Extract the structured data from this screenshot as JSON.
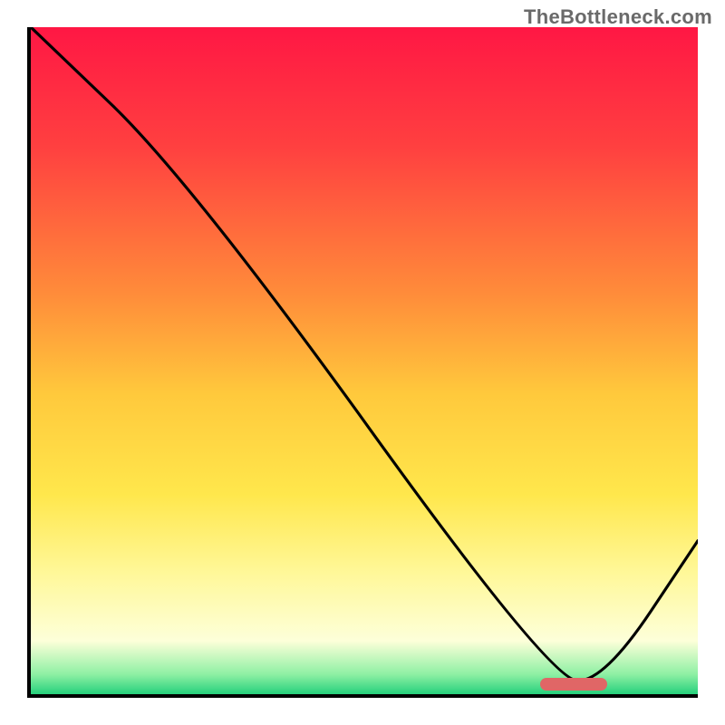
{
  "watermark": "TheBottleneck.com",
  "chart_data": {
    "type": "line",
    "title": "",
    "xlabel": "",
    "ylabel": "",
    "xlim": [
      0,
      100
    ],
    "ylim": [
      0,
      100
    ],
    "grid": false,
    "legend": false,
    "series": [
      {
        "name": "bottleneck-curve",
        "x": [
          0,
          24,
          78,
          86,
          100
        ],
        "y": [
          100,
          77,
          2,
          2,
          23
        ]
      }
    ],
    "optimal_range": {
      "x_start": 76,
      "x_end": 86,
      "y": 2
    },
    "gradient_stops": [
      {
        "pct": 0,
        "color": "#ff1744"
      },
      {
        "pct": 18,
        "color": "#ff4040"
      },
      {
        "pct": 40,
        "color": "#ff8c3a"
      },
      {
        "pct": 55,
        "color": "#ffc93c"
      },
      {
        "pct": 70,
        "color": "#ffe74c"
      },
      {
        "pct": 82,
        "color": "#fff89a"
      },
      {
        "pct": 92,
        "color": "#fdffd9"
      },
      {
        "pct": 97,
        "color": "#8ff0a4"
      },
      {
        "pct": 100,
        "color": "#26d07c"
      }
    ]
  }
}
